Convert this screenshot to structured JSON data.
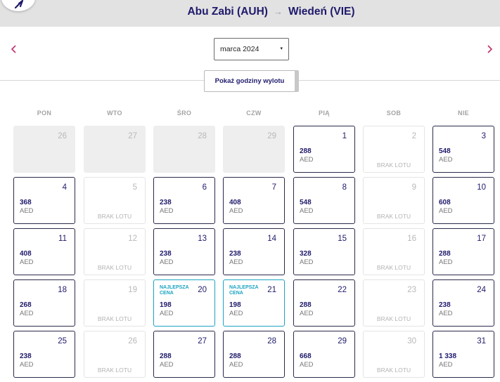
{
  "header": {
    "origin": "Abu Zabi (AUH)",
    "arrow": "→",
    "destination": "Wiedeń (VIE)"
  },
  "month_selector": {
    "value": "marca 2024",
    "caret": "▾"
  },
  "show_times_button": "Pokaż godziny wylotu",
  "weekdays": [
    "PON",
    "WTO",
    "ŚRO",
    "CZW",
    "PIĄ",
    "SOB",
    "NIE"
  ],
  "labels": {
    "currency": "AED",
    "no_flight": "BRAK LOTU",
    "best_price": "NAJLEPSZA CENA"
  },
  "colors": {
    "brand_navy": "#1f1a6b",
    "best_price_teal": "#1ba3c1",
    "nav_arrow": "#c0306a"
  },
  "weeks": [
    [
      {
        "day": "26",
        "state": "empty"
      },
      {
        "day": "27",
        "state": "empty"
      },
      {
        "day": "28",
        "state": "empty"
      },
      {
        "day": "29",
        "state": "empty"
      },
      {
        "day": "1",
        "state": "price",
        "price": "288"
      },
      {
        "day": "2",
        "state": "none"
      },
      {
        "day": "3",
        "state": "price",
        "price": "548"
      }
    ],
    [
      {
        "day": "4",
        "state": "price",
        "price": "368"
      },
      {
        "day": "5",
        "state": "none"
      },
      {
        "day": "6",
        "state": "price",
        "price": "238"
      },
      {
        "day": "7",
        "state": "price",
        "price": "408"
      },
      {
        "day": "8",
        "state": "price",
        "price": "548"
      },
      {
        "day": "9",
        "state": "none"
      },
      {
        "day": "10",
        "state": "price",
        "price": "608"
      }
    ],
    [
      {
        "day": "11",
        "state": "price",
        "price": "408"
      },
      {
        "day": "12",
        "state": "none"
      },
      {
        "day": "13",
        "state": "price",
        "price": "238"
      },
      {
        "day": "14",
        "state": "price",
        "price": "238"
      },
      {
        "day": "15",
        "state": "price",
        "price": "328"
      },
      {
        "day": "16",
        "state": "none"
      },
      {
        "day": "17",
        "state": "price",
        "price": "288"
      }
    ],
    [
      {
        "day": "18",
        "state": "price",
        "price": "268"
      },
      {
        "day": "19",
        "state": "none"
      },
      {
        "day": "20",
        "state": "best",
        "price": "198"
      },
      {
        "day": "21",
        "state": "best",
        "price": "198"
      },
      {
        "day": "22",
        "state": "price",
        "price": "288"
      },
      {
        "day": "23",
        "state": "none"
      },
      {
        "day": "24",
        "state": "price",
        "price": "238"
      }
    ],
    [
      {
        "day": "25",
        "state": "price",
        "price": "238"
      },
      {
        "day": "26",
        "state": "none"
      },
      {
        "day": "27",
        "state": "price",
        "price": "288"
      },
      {
        "day": "28",
        "state": "price",
        "price": "288"
      },
      {
        "day": "29",
        "state": "price",
        "price": "668"
      },
      {
        "day": "30",
        "state": "none"
      },
      {
        "day": "31",
        "state": "price",
        "price": "1 338"
      }
    ]
  ]
}
